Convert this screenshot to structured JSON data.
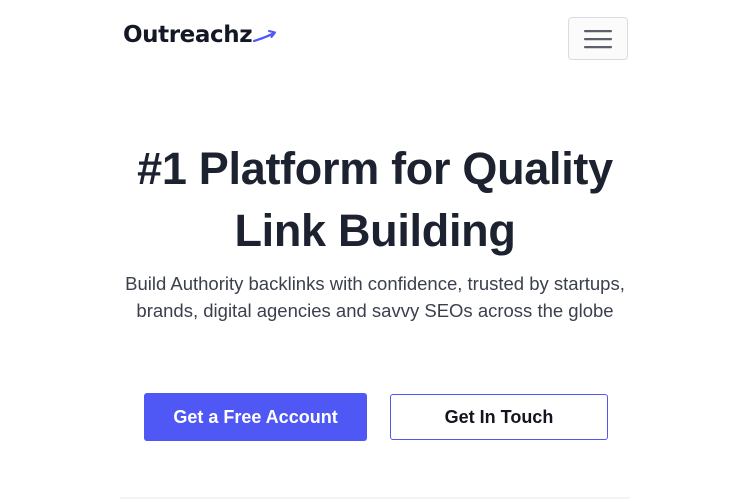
{
  "header": {
    "brand": "Outreachz",
    "brand_icon": "outreachz-logo-swoosh-icon",
    "menu_icon": "hamburger-menu-icon"
  },
  "hero": {
    "title": "#1 Platform for Quality Link Building",
    "subtitle": "Build Authority backlinks with confidence, trusted by startups, brands, digital agencies and savvy SEOs across the globe"
  },
  "actions": {
    "primary_label": "Get a Free Account",
    "secondary_label": "Get In Touch"
  },
  "colors": {
    "accent": "#4f57f4",
    "text": "#1d2230",
    "background": "#ffffff"
  }
}
